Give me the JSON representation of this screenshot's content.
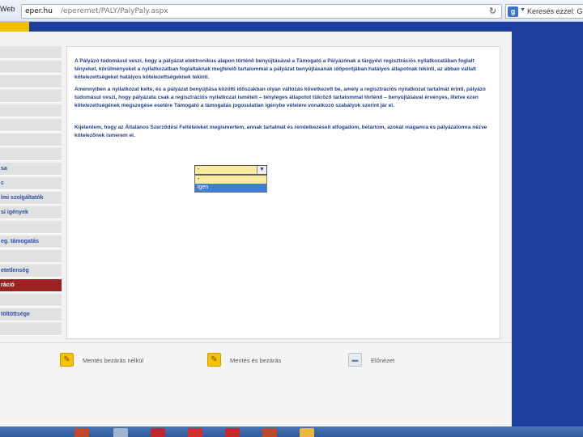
{
  "browser": {
    "tab_fragment": "Web",
    "url_host": "eper.hu",
    "url_path": "/eperemet/PALY/PalyPaly.aspx",
    "search_text": "Keresés ezzel: Go",
    "star_glyph": "☆",
    "refresh_glyph": "↻",
    "google_glyph": "g"
  },
  "sidebar": {
    "items": [
      {
        "label": ""
      },
      {
        "label": ""
      },
      {
        "label": ""
      },
      {
        "label": ""
      },
      {
        "label": ""
      },
      {
        "label": ""
      },
      {
        "label": ""
      },
      {
        "label": ""
      },
      {
        "label": "sa"
      },
      {
        "label": "c"
      },
      {
        "label": "lmi szolgáltatók"
      },
      {
        "label": "si igények"
      },
      {
        "label": ""
      },
      {
        "label": "eg. támogatás"
      },
      {
        "label": ""
      },
      {
        "label": "etetlenség"
      },
      {
        "label": "ráció",
        "active": true
      },
      {
        "label": ""
      },
      {
        "label": "töltöttsége"
      },
      {
        "label": ""
      }
    ]
  },
  "content": {
    "paragraph1": "A Pályázó tudomásul veszi, hogy a pályázat elektronikus alapon történő benyújtásával a Támogató a Pályázónak a tárgyévi regisztrációs nyilatkozatában foglalt tényeket, körülményeket a nyilatkozatban foglaltaknak megfelelő tartalommal a pályázat benyújtásának időpontjában hatályos állapotnak tekinti, az abban vállalt kötelezettségeket hatályos kötelezettségeknek tekinti.",
    "paragraph2": "Amennyiben a nyilatkozat kelte, és a pályázat benyújtása közötti időszakban olyan változás következett be, amely a regisztrációs nyilatkozat tartalmát érinti, pályázó tudomásul veszi, hogy pályázata csak a regisztrációs nyilatkozat ismételt – tényleges állapotot tükröző tartalommal történő – benyújtásával érvényes, illetve ezen kötelezettségének megszegése esetére Támogató a támogatás jogosulatlan igénybe vételére vonatkozó szabályok szerint jár el.",
    "paragraph3": "Kijelentem, hogy az Általános Szerződési Feltételeket megismertem, annak tartalmát és rendelkezéseit elfogadom, betartom, azokat magamra és pályázatomra nézve kötelezőnek ismerem el."
  },
  "dropdown": {
    "value": "-",
    "arrow_glyph": "▼",
    "options": [
      "-",
      "igen"
    ]
  },
  "footer": {
    "buttons": [
      {
        "label": "Mentés bezárás nélkül",
        "icon": "pencil-icon",
        "glyph": "✎"
      },
      {
        "label": "Mentés és bezárás",
        "icon": "pencil-icon",
        "glyph": "✎"
      },
      {
        "label": "Előnézet",
        "icon": "preview-icon",
        "glyph": "▬"
      }
    ]
  },
  "colors": {
    "brand_blue": "#1c3f9e",
    "brand_yellow": "#f0c000",
    "active_item": "#9b2222"
  }
}
